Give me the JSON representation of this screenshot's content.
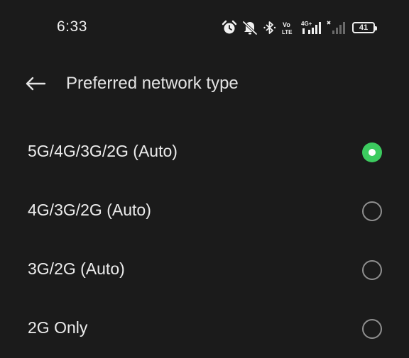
{
  "status_bar": {
    "time": "6:33",
    "icons": [
      "alarm-icon",
      "mute-icon",
      "bluetooth-icon",
      "volte-icon",
      "signal-4g-icon",
      "signal-no-service-icon"
    ],
    "volte_top": "Vo",
    "volte_bottom": "LTE",
    "network_label": "4G+",
    "battery_level": "41"
  },
  "header": {
    "title": "Preferred network type"
  },
  "options": [
    {
      "label": "5G/4G/3G/2G (Auto)",
      "selected": true
    },
    {
      "label": "4G/3G/2G (Auto)",
      "selected": false
    },
    {
      "label": "3G/2G (Auto)",
      "selected": false
    },
    {
      "label": "2G Only",
      "selected": false
    }
  ],
  "colors": {
    "background": "#1b1b1b",
    "accent": "#3ccb5f",
    "text": "#ececec"
  }
}
